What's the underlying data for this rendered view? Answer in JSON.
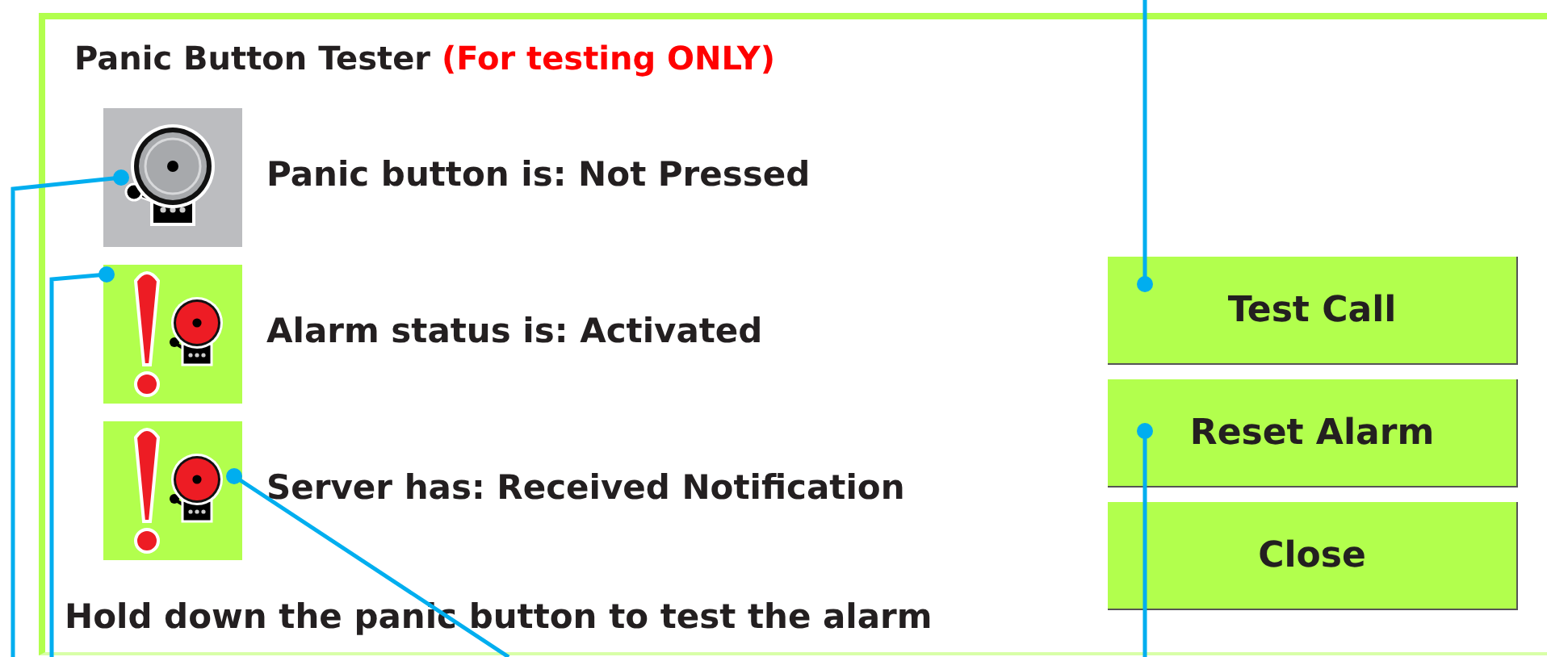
{
  "title": {
    "text": "Panic Button Tester",
    "note": "(For testing ONLY)"
  },
  "statuses": [
    {
      "kind": "idle",
      "label": "Panic button is: Not Pressed"
    },
    {
      "kind": "alert",
      "label": "Alarm status is: Activated"
    },
    {
      "kind": "alert",
      "label": "Server has: Received Notification"
    }
  ],
  "buttons": [
    "Test Call",
    "Reset Alarm",
    "Close"
  ],
  "instruction": "Hold down the panic button to test the alarm"
}
